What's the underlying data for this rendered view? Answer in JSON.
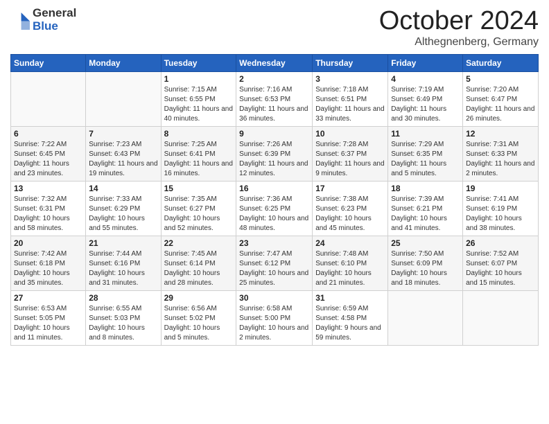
{
  "logo": {
    "general": "General",
    "blue": "Blue"
  },
  "title": "October 2024",
  "location": "Althegnenberg, Germany",
  "days_header": [
    "Sunday",
    "Monday",
    "Tuesday",
    "Wednesday",
    "Thursday",
    "Friday",
    "Saturday"
  ],
  "weeks": [
    [
      {
        "day": "",
        "info": ""
      },
      {
        "day": "",
        "info": ""
      },
      {
        "day": "1",
        "info": "Sunrise: 7:15 AM\nSunset: 6:55 PM\nDaylight: 11 hours and 40 minutes."
      },
      {
        "day": "2",
        "info": "Sunrise: 7:16 AM\nSunset: 6:53 PM\nDaylight: 11 hours and 36 minutes."
      },
      {
        "day": "3",
        "info": "Sunrise: 7:18 AM\nSunset: 6:51 PM\nDaylight: 11 hours and 33 minutes."
      },
      {
        "day": "4",
        "info": "Sunrise: 7:19 AM\nSunset: 6:49 PM\nDaylight: 11 hours and 30 minutes."
      },
      {
        "day": "5",
        "info": "Sunrise: 7:20 AM\nSunset: 6:47 PM\nDaylight: 11 hours and 26 minutes."
      }
    ],
    [
      {
        "day": "6",
        "info": "Sunrise: 7:22 AM\nSunset: 6:45 PM\nDaylight: 11 hours and 23 minutes."
      },
      {
        "day": "7",
        "info": "Sunrise: 7:23 AM\nSunset: 6:43 PM\nDaylight: 11 hours and 19 minutes."
      },
      {
        "day": "8",
        "info": "Sunrise: 7:25 AM\nSunset: 6:41 PM\nDaylight: 11 hours and 16 minutes."
      },
      {
        "day": "9",
        "info": "Sunrise: 7:26 AM\nSunset: 6:39 PM\nDaylight: 11 hours and 12 minutes."
      },
      {
        "day": "10",
        "info": "Sunrise: 7:28 AM\nSunset: 6:37 PM\nDaylight: 11 hours and 9 minutes."
      },
      {
        "day": "11",
        "info": "Sunrise: 7:29 AM\nSunset: 6:35 PM\nDaylight: 11 hours and 5 minutes."
      },
      {
        "day": "12",
        "info": "Sunrise: 7:31 AM\nSunset: 6:33 PM\nDaylight: 11 hours and 2 minutes."
      }
    ],
    [
      {
        "day": "13",
        "info": "Sunrise: 7:32 AM\nSunset: 6:31 PM\nDaylight: 10 hours and 58 minutes."
      },
      {
        "day": "14",
        "info": "Sunrise: 7:33 AM\nSunset: 6:29 PM\nDaylight: 10 hours and 55 minutes."
      },
      {
        "day": "15",
        "info": "Sunrise: 7:35 AM\nSunset: 6:27 PM\nDaylight: 10 hours and 52 minutes."
      },
      {
        "day": "16",
        "info": "Sunrise: 7:36 AM\nSunset: 6:25 PM\nDaylight: 10 hours and 48 minutes."
      },
      {
        "day": "17",
        "info": "Sunrise: 7:38 AM\nSunset: 6:23 PM\nDaylight: 10 hours and 45 minutes."
      },
      {
        "day": "18",
        "info": "Sunrise: 7:39 AM\nSunset: 6:21 PM\nDaylight: 10 hours and 41 minutes."
      },
      {
        "day": "19",
        "info": "Sunrise: 7:41 AM\nSunset: 6:19 PM\nDaylight: 10 hours and 38 minutes."
      }
    ],
    [
      {
        "day": "20",
        "info": "Sunrise: 7:42 AM\nSunset: 6:18 PM\nDaylight: 10 hours and 35 minutes."
      },
      {
        "day": "21",
        "info": "Sunrise: 7:44 AM\nSunset: 6:16 PM\nDaylight: 10 hours and 31 minutes."
      },
      {
        "day": "22",
        "info": "Sunrise: 7:45 AM\nSunset: 6:14 PM\nDaylight: 10 hours and 28 minutes."
      },
      {
        "day": "23",
        "info": "Sunrise: 7:47 AM\nSunset: 6:12 PM\nDaylight: 10 hours and 25 minutes."
      },
      {
        "day": "24",
        "info": "Sunrise: 7:48 AM\nSunset: 6:10 PM\nDaylight: 10 hours and 21 minutes."
      },
      {
        "day": "25",
        "info": "Sunrise: 7:50 AM\nSunset: 6:09 PM\nDaylight: 10 hours and 18 minutes."
      },
      {
        "day": "26",
        "info": "Sunrise: 7:52 AM\nSunset: 6:07 PM\nDaylight: 10 hours and 15 minutes."
      }
    ],
    [
      {
        "day": "27",
        "info": "Sunrise: 6:53 AM\nSunset: 5:05 PM\nDaylight: 10 hours and 11 minutes."
      },
      {
        "day": "28",
        "info": "Sunrise: 6:55 AM\nSunset: 5:03 PM\nDaylight: 10 hours and 8 minutes."
      },
      {
        "day": "29",
        "info": "Sunrise: 6:56 AM\nSunset: 5:02 PM\nDaylight: 10 hours and 5 minutes."
      },
      {
        "day": "30",
        "info": "Sunrise: 6:58 AM\nSunset: 5:00 PM\nDaylight: 10 hours and 2 minutes."
      },
      {
        "day": "31",
        "info": "Sunrise: 6:59 AM\nSunset: 4:58 PM\nDaylight: 9 hours and 59 minutes."
      },
      {
        "day": "",
        "info": ""
      },
      {
        "day": "",
        "info": ""
      }
    ]
  ]
}
